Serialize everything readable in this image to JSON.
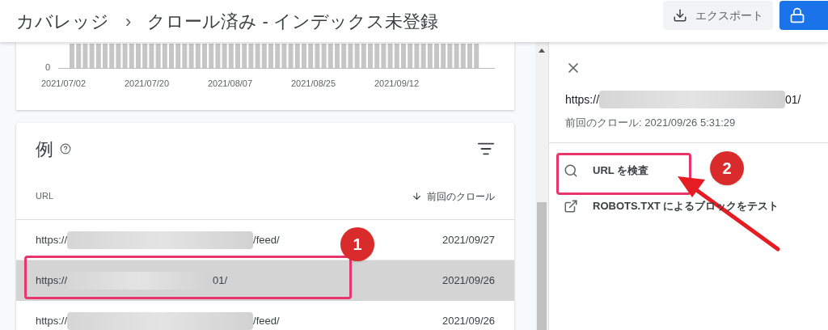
{
  "header": {
    "breadcrumb": [
      "カバレッジ",
      "クロール済み - インデックス未登録"
    ],
    "separator": "›",
    "export_button": "エクスポート"
  },
  "chart": {
    "y_label": "0",
    "x_labels": [
      "2021/07/02",
      "2021/07/20",
      "2021/08/07",
      "2021/08/25",
      "2021/09/12"
    ]
  },
  "examples": {
    "title": "例",
    "columns": [
      "URL",
      "前回のクロール"
    ],
    "rows": [
      {
        "url_start": "https://",
        "url_end": "/feed/",
        "date": "2021/09/27",
        "selected": false
      },
      {
        "url_start": "https://",
        "url_end": "01/",
        "date": "2021/09/26",
        "selected": true
      },
      {
        "url_start": "https://",
        "url_end": "/feed/",
        "date": "2021/09/26",
        "selected": false
      }
    ]
  },
  "details_panel": {
    "url_start": "https://",
    "url_end": "01/",
    "last_crawl": "前回のクロール: 2021/09/26 5:31:29",
    "actions": [
      {
        "kind": "inspect",
        "label": "URL を検査"
      },
      {
        "kind": "external",
        "label": "ROBOTS.TXT によるブロックをテスト"
      }
    ]
  },
  "annotations": [
    {
      "label": "1"
    },
    {
      "label": "2"
    }
  ]
}
